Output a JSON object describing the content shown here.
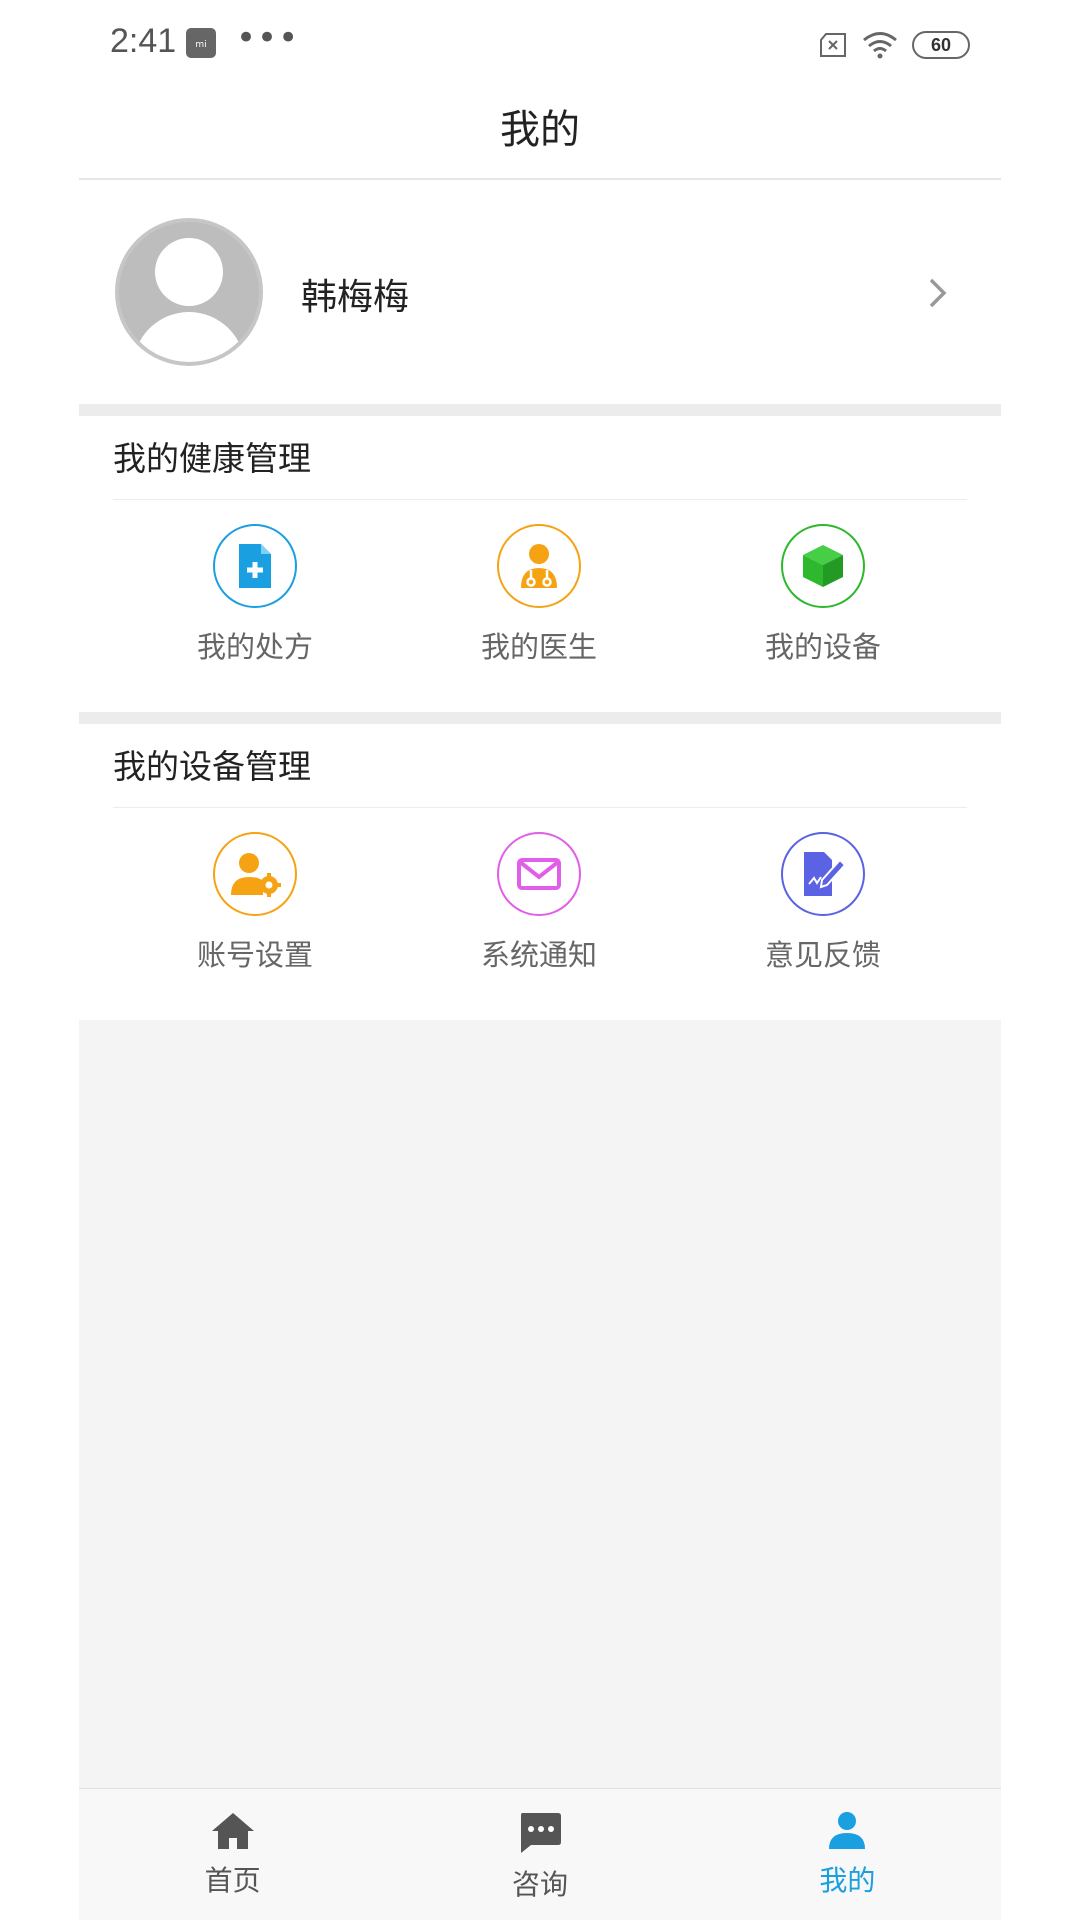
{
  "status_bar": {
    "time": "2:41",
    "battery": "60"
  },
  "header": {
    "title": "我的"
  },
  "profile": {
    "name": "韩梅梅"
  },
  "health_section": {
    "title": "我的健康管理",
    "items": [
      {
        "label": "我的处方",
        "icon": "prescription-icon",
        "color": "#1a9fe0"
      },
      {
        "label": "我的医生",
        "icon": "doctor-icon",
        "color": "#f5a313"
      },
      {
        "label": "我的设备",
        "icon": "device-cube-icon",
        "color": "#2db82d"
      }
    ]
  },
  "device_section": {
    "title": "我的设备管理",
    "items": [
      {
        "label": "账号设置",
        "icon": "account-settings-icon",
        "color": "#f5a313"
      },
      {
        "label": "系统通知",
        "icon": "mail-icon",
        "color": "#e25ee8"
      },
      {
        "label": "意见反馈",
        "icon": "feedback-icon",
        "color": "#5b62e3"
      }
    ]
  },
  "tabbar": {
    "tabs": [
      {
        "label": "首页",
        "icon": "home-icon"
      },
      {
        "label": "咨询",
        "icon": "chat-icon"
      },
      {
        "label": "我的",
        "icon": "person-icon",
        "active": true
      }
    ]
  },
  "colors": {
    "accent": "#1a9fe0",
    "background": "#f4f4f4"
  }
}
